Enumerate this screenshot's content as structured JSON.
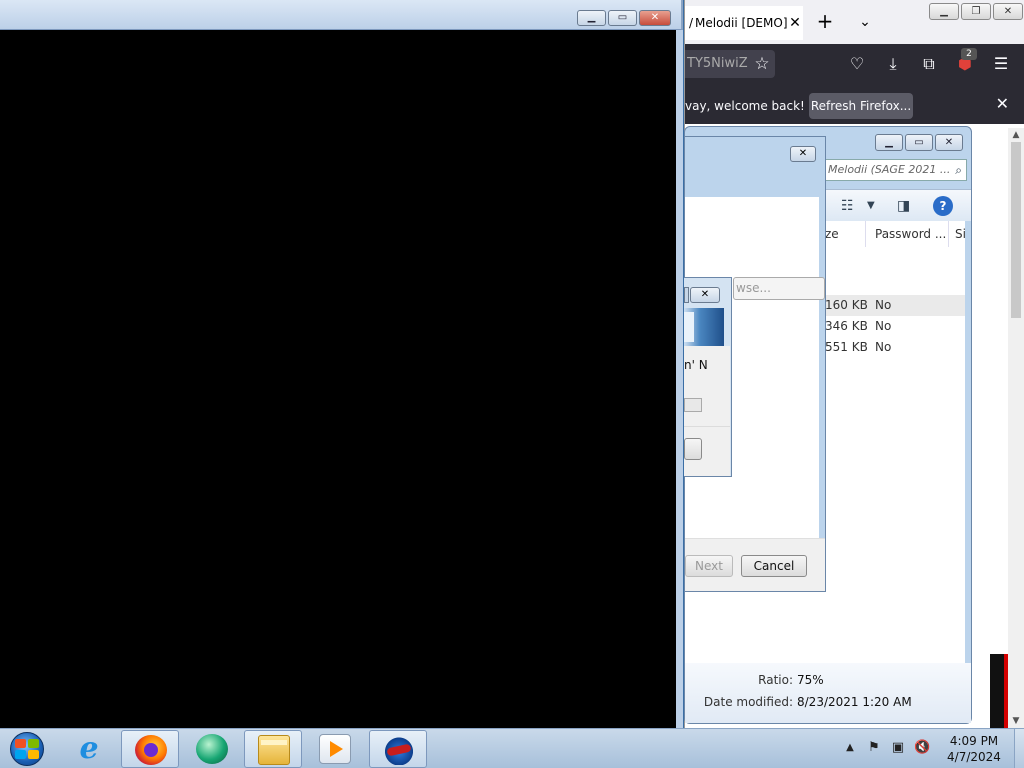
{
  "firefox": {
    "tab_title": "Melodii [DEMO]",
    "tab_prefix": "/",
    "url_fragment": "TY5NiwiZ",
    "badge_count": "2",
    "notification_text": "vay, welcome back!",
    "refresh_button": "Refresh Firefox...",
    "icons": [
      "star-icon",
      "pocket-icon",
      "download-icon",
      "extensions-icon",
      "ublock-icon",
      "menu-icon"
    ]
  },
  "archive_window": {
    "search_placeholder": "Melodii (SAGE 2021 ...",
    "columns": [
      "ze",
      "Password ...",
      "Si"
    ],
    "rows": [
      {
        "size": "160 KB",
        "password": "No"
      },
      {
        "size": "346 KB",
        "password": "No"
      },
      {
        "size": "551 KB",
        "password": "No"
      }
    ],
    "details": {
      "ratio_label": "Ratio:",
      "ratio_value": "75%",
      "modified_label": "Date modified:",
      "modified_value": "8/23/2021 1:20 AM"
    }
  },
  "wizard": {
    "browse_button": "wse...",
    "next_button": "Next",
    "cancel_button": "Cancel"
  },
  "small_dialog": {
    "text": "n' N"
  },
  "taskbar": {
    "apps": [
      "internet-explorer",
      "firefox",
      "green-app",
      "windows-explorer",
      "media-player",
      "fish-app"
    ],
    "time": "4:09 PM",
    "date": "4/7/2024"
  },
  "colors": {
    "desktop_accent": "#3a6ea5",
    "firefox_dark": "#2b2a33",
    "close_red": "#c74c3c",
    "taskbar": "#a7c0da"
  }
}
